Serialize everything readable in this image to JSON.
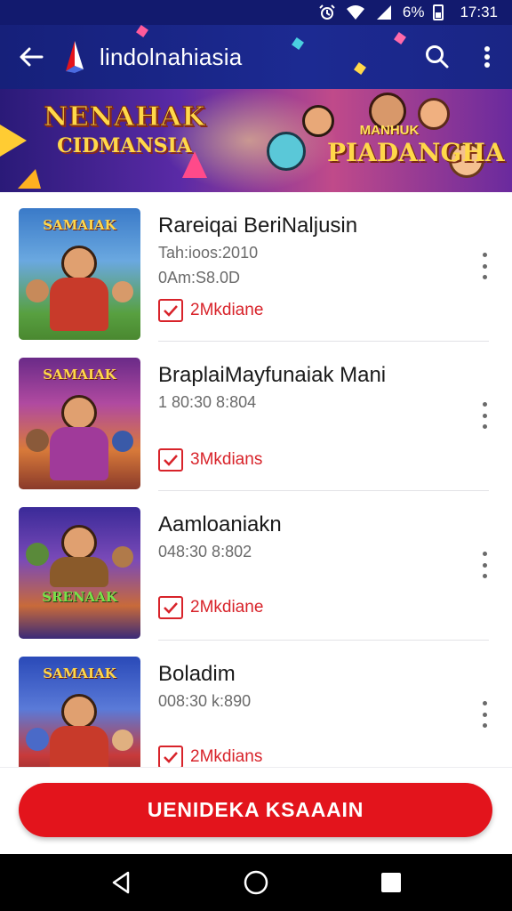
{
  "status_bar": {
    "battery_text": "6%",
    "time": "17:31"
  },
  "app_bar": {
    "title": "lindolnahiasia"
  },
  "banner": {
    "left_line1": "NENAHAK",
    "left_line2": "CIDMANSIA",
    "right_line1": "MANHUK",
    "right_line2": "PIADANGHA"
  },
  "items": [
    {
      "name": "Rareiqai BeriNaljusin",
      "meta1": "Tah:ioos:2010",
      "meta2": "0Am:S8.0D",
      "tag": "2Mkdiane",
      "thumb_title": "SAMAIAK"
    },
    {
      "name": "BraplaiMayfunaiak Mani",
      "meta1": "1 80:30 8:804",
      "meta2": "",
      "tag": "3Mkdians",
      "thumb_title": "SAMAIAK"
    },
    {
      "name": "Aamloaniakn",
      "meta1": "048:30 8:802",
      "meta2": "",
      "tag": "2Mkdiane",
      "thumb_title": "SRENAAK"
    },
    {
      "name": "Boladim",
      "meta1": "008:30 k:890",
      "meta2": "",
      "tag": "2Mkdians",
      "thumb_title": "SAMAIAK"
    }
  ],
  "cta": {
    "label": "UENIDEKA KSAAAIN"
  },
  "colors": {
    "appbar": "#16207a",
    "accent": "#e3141c"
  },
  "icons": [
    "back-arrow-icon",
    "search-icon",
    "more-vert-icon",
    "checkbox-icon",
    "nav-back-icon",
    "nav-home-icon",
    "nav-recents-icon"
  ]
}
